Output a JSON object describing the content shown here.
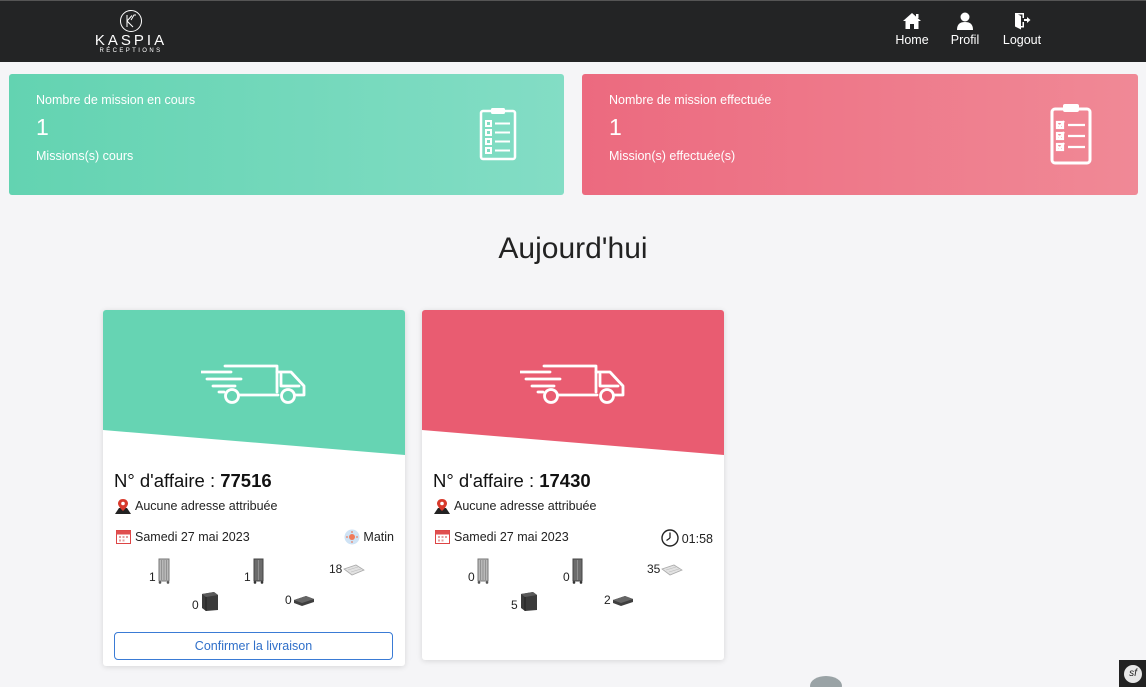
{
  "brand": {
    "name": "KASPIA",
    "subtitle": "RÉCEPTIONS"
  },
  "nav": [
    {
      "label": "Home",
      "icon": "home-icon"
    },
    {
      "label": "Profil",
      "icon": "user-icon"
    },
    {
      "label": "Logout",
      "icon": "logout-icon"
    }
  ],
  "stats": {
    "in_progress": {
      "title": "Nombre de mission en cours",
      "value": "1",
      "subtitle": "Missions(s) cours",
      "icon": "clipboard-list-icon",
      "color": "#63d3b1"
    },
    "done": {
      "title": "Nombre de mission effectuée",
      "value": "1",
      "subtitle": "Mission(s) effectuée(s)",
      "icon": "clipboard-check-icon",
      "color": "#ec6a7f"
    }
  },
  "section_title": "Aujourd'hui",
  "missions": [
    {
      "number_label": "N° d'affaire : ",
      "number": "77516",
      "address": "Aucune adresse attribuée",
      "date": "Samedi 27 mai 2023",
      "slot": "Matin",
      "slot_icon": "sun-icon",
      "header_color": "#63d3b1",
      "equipment": {
        "rack_tall": "1",
        "rack_small": "1",
        "tray": "18",
        "box": "0",
        "flat_case": "0"
      },
      "confirm_label": "Confirmer la livraison"
    },
    {
      "number_label": "N° d'affaire : ",
      "number": "17430",
      "address": "Aucune adresse attribuée",
      "date": "Samedi 27 mai 2023",
      "slot": "01:58",
      "slot_icon": "clock-icon",
      "header_color": "#e95c71",
      "equipment": {
        "rack_tall": "0",
        "rack_small": "0",
        "tray": "35",
        "box": "5",
        "flat_case": "2"
      }
    }
  ]
}
